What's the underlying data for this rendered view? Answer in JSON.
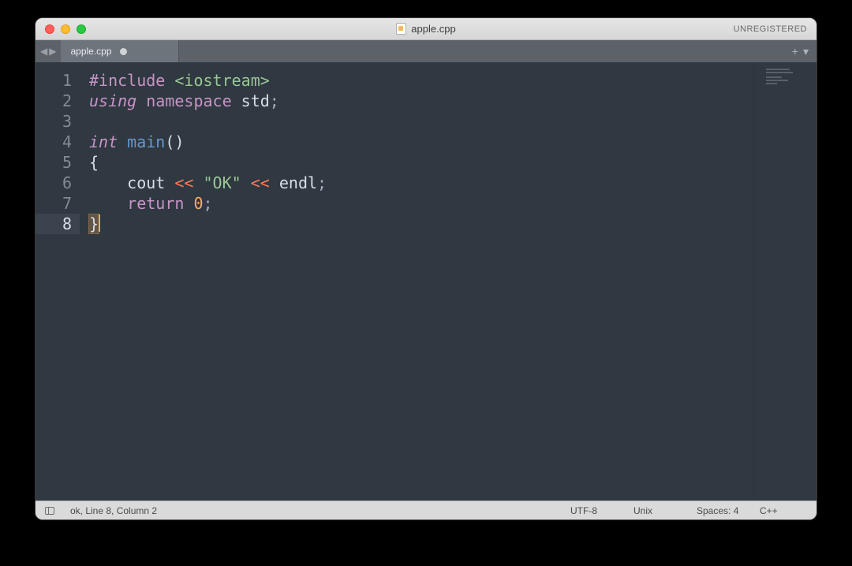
{
  "window": {
    "title": "apple.cpp",
    "unregistered": "UNREGISTERED"
  },
  "tabs": {
    "active": {
      "label": "apple.cpp",
      "dirty": true
    }
  },
  "editor": {
    "lines": [
      [
        {
          "t": "#include ",
          "c": "kw2"
        },
        {
          "t": "<iostream>",
          "c": "str"
        }
      ],
      [
        {
          "t": "using ",
          "c": "kw"
        },
        {
          "t": "namespace ",
          "c": "kw2"
        },
        {
          "t": "std",
          "c": "std"
        },
        {
          "t": ";",
          "c": "semi"
        }
      ],
      [],
      [
        {
          "t": "int ",
          "c": "kw"
        },
        {
          "t": "main",
          "c": "func"
        },
        {
          "t": "()",
          "c": "punct"
        }
      ],
      [
        {
          "t": "{",
          "c": "punct"
        }
      ],
      [
        {
          "t": "    cout ",
          "c": "ident"
        },
        {
          "t": "<<",
          "c": "op"
        },
        {
          "t": " ",
          "c": "ident"
        },
        {
          "t": "\"OK\"",
          "c": "str"
        },
        {
          "t": " ",
          "c": "ident"
        },
        {
          "t": "<<",
          "c": "op"
        },
        {
          "t": " endl",
          "c": "ident"
        },
        {
          "t": ";",
          "c": "semi"
        }
      ],
      [
        {
          "t": "    ",
          "c": "ident"
        },
        {
          "t": "return ",
          "c": "kw2"
        },
        {
          "t": "0",
          "c": "num"
        },
        {
          "t": ";",
          "c": "semi"
        }
      ],
      [
        {
          "t": "}",
          "c": "punct bracket-hl"
        }
      ]
    ],
    "current_line": 8,
    "cursor_after_last": true
  },
  "status": {
    "left": "ok, Line 8, Column 2",
    "encoding": "UTF-8",
    "line_ending": "Unix",
    "indent": "Spaces: 4",
    "syntax": "C++"
  }
}
